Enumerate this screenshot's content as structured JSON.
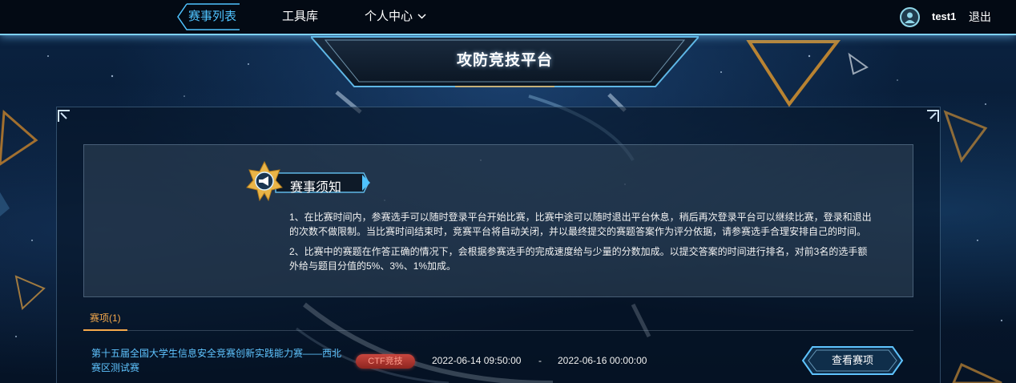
{
  "nav": {
    "items": [
      {
        "label": "赛事列表",
        "active": true
      },
      {
        "label": "工具库",
        "active": false
      },
      {
        "label": "个人中心",
        "active": false
      }
    ],
    "username": "test1",
    "logout": "退出"
  },
  "banner": {
    "title": "攻防竞技平台"
  },
  "notice": {
    "title": "赛事须知",
    "lines": [
      "1、在比赛时间内，参赛选手可以随时登录平台开始比赛，比赛中途可以随时退出平台休息，稍后再次登录平台可以继续比赛，登录和退出",
      "的次数不做限制。当比赛时间结束时，竞赛平台将自动关闭，并以最终提交的赛题答案作为评分依据，请参赛选手合理安排自己的时间。",
      "2、比赛中的赛题在作答正确的情况下，会根据参赛选手的完成速度给与少量的分数加成。以提交答案的时间进行排名，对前3名的选手额",
      "外给与题目分值的5%、3%、1%加成。"
    ]
  },
  "tab": {
    "label": "赛项(1)"
  },
  "competition": {
    "name": "第十五届全国大学生信息安全竞赛创新实践能力赛——西北赛区测试赛",
    "tag": "CTF竞技",
    "start": "2022-06-14 09:50:00",
    "separator": "-",
    "end": "2022-06-16 00:00:00",
    "button": "查看赛项"
  },
  "colors": {
    "accent": "#4fc3ff",
    "tab_active": "#f5a94b",
    "tag_bg": "#c9473f"
  },
  "icons": [
    "user-avatar-icon",
    "chevron-down-icon",
    "megaphone-icon"
  ]
}
